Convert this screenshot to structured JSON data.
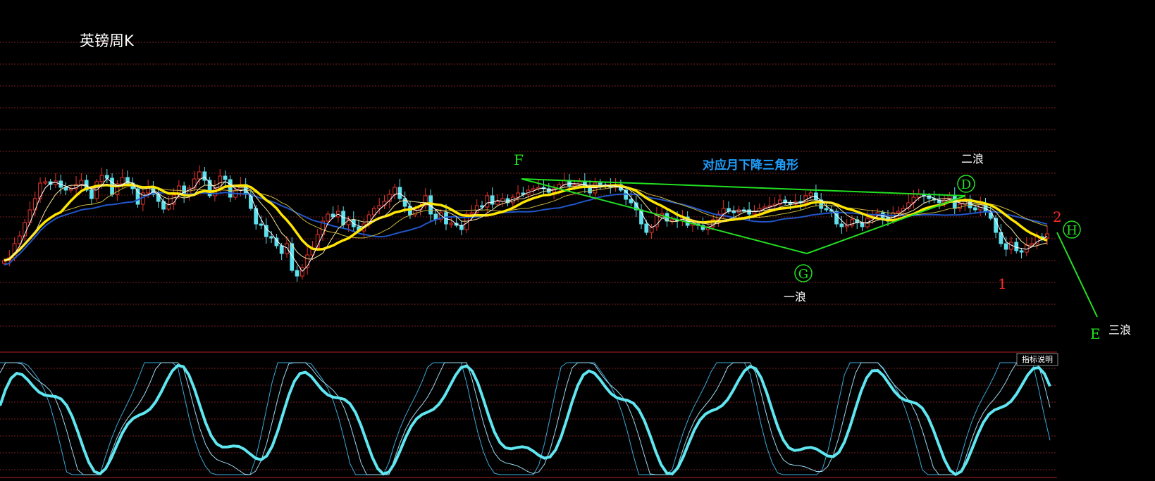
{
  "title": "英镑周K",
  "panel_button": "指标说明",
  "annotations": {
    "triangle_label": "对应月下降三角形",
    "wave1": "一浪",
    "wave2": "二浪",
    "wave3": "三浪",
    "F": "F",
    "G": "G",
    "D": "D",
    "H": "H",
    "E": "E",
    "n1": "1",
    "n2": "2"
  },
  "colors": {
    "background": "#000000",
    "grid": "#7a1f1f",
    "up_candle": "#e8322b",
    "down_candle": "#5fe0ec",
    "ma_white": "#ffffff",
    "ma_yellow": "#ffe600",
    "ma_beige": "#f2e3a0",
    "ma_olive": "#c8b43c",
    "ma_blue": "#2255c8",
    "trend_green": "#22e022",
    "label_blue": "#1ea0ff",
    "label_red": "#ff2a2a",
    "oscillator": "#5fe6f0"
  },
  "chart_data": {
    "type": "candlestick",
    "series": [
      {
        "name": "weekly",
        "values": [
          370,
          366,
          346,
          335,
          316,
          298,
          282,
          260,
          258,
          262,
          257,
          266,
          270,
          268,
          262,
          256,
          270,
          282,
          258,
          249,
          253,
          276,
          261,
          252,
          260,
          268,
          290,
          274,
          266,
          276,
          286,
          297,
          290,
          277,
          264,
          278,
          267,
          254,
          244,
          256,
          278,
          268,
          250,
          255,
          280,
          270,
          262,
          276,
          296,
          318,
          320,
          336,
          338,
          349,
          360,
          346,
          384,
          392,
          380,
          362,
          352,
          333,
          314,
          304,
          308,
          300,
          319,
          312,
          322,
          328,
          318,
          305,
          296,
          292,
          286,
          276,
          266,
          282,
          293,
          305,
          298,
          292,
          278,
          304,
          312,
          302,
          318,
          317,
          320,
          326,
          304,
          302,
          292,
          294,
          278,
          290,
          286,
          282,
          288,
          280,
          274,
          276,
          270,
          268,
          266,
          268,
          273,
          268,
          262,
          256,
          264,
          262,
          258,
          266,
          274,
          260,
          263,
          264,
          266,
          262,
          270,
          283,
          288,
          298,
          318,
          330,
          322,
          305,
          303,
          314,
          312,
          314,
          308,
          320,
          318,
          320,
          326,
          322,
          312,
          304,
          296,
          300,
          302,
          298,
          298,
          304,
          300,
          296,
          294,
          292,
          290,
          284,
          288,
          290,
          286,
          288,
          278,
          274,
          284,
          296,
          298,
          300,
          318,
          322,
          320,
          312,
          316,
          322,
          310,
          306,
          302,
          309,
          314,
          302,
          300,
          296,
          288,
          280,
          276,
          278,
          282,
          284,
          288,
          284,
          278,
          296,
          290,
          283,
          295,
          298,
          290,
          300,
          310,
          330,
          346,
          354,
          344,
          356,
          358,
          348,
          346,
          336,
          338,
          332
        ]
      }
    ],
    "moving_averages": [
      "white",
      "yellow",
      "beige",
      "olive",
      "blue"
    ],
    "oscillator": {
      "type": "stochastic",
      "range": [
        0,
        100
      ]
    },
    "grid": true
  }
}
